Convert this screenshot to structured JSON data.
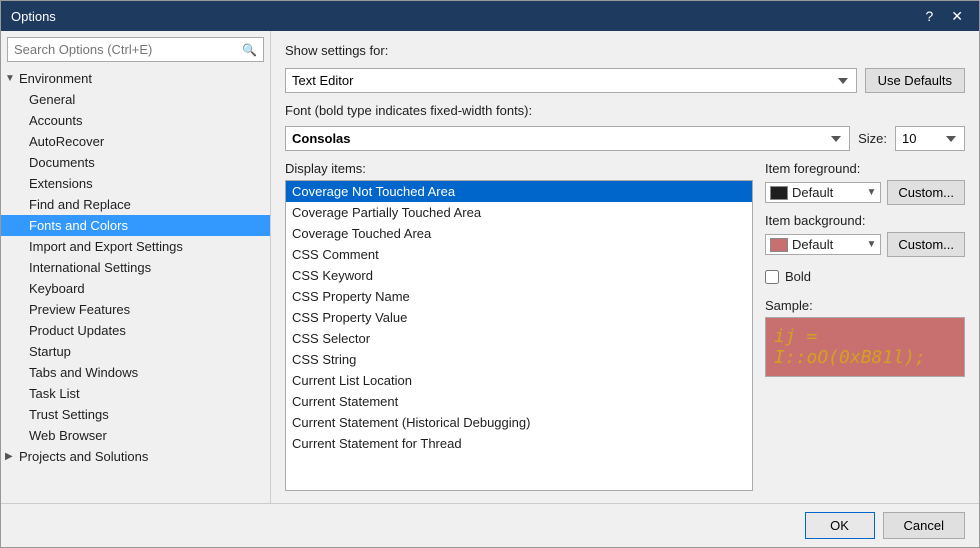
{
  "dialog": {
    "title": "Options",
    "help_label": "?",
    "close_label": "✕"
  },
  "search": {
    "placeholder": "Search Options (Ctrl+E)"
  },
  "tree": {
    "environment_label": "Environment",
    "environment_expanded": true,
    "children": [
      {
        "id": "general",
        "label": "General"
      },
      {
        "id": "accounts",
        "label": "Accounts"
      },
      {
        "id": "autorecover",
        "label": "AutoRecover"
      },
      {
        "id": "documents",
        "label": "Documents"
      },
      {
        "id": "extensions",
        "label": "Extensions"
      },
      {
        "id": "find-replace",
        "label": "Find and Replace"
      },
      {
        "id": "fonts-colors",
        "label": "Fonts and Colors",
        "selected": true
      },
      {
        "id": "import-export",
        "label": "Import and Export Settings"
      },
      {
        "id": "international",
        "label": "International Settings"
      },
      {
        "id": "keyboard",
        "label": "Keyboard"
      },
      {
        "id": "preview",
        "label": "Preview Features"
      },
      {
        "id": "product-updates",
        "label": "Product Updates"
      },
      {
        "id": "startup",
        "label": "Startup"
      },
      {
        "id": "tabs-windows",
        "label": "Tabs and Windows"
      },
      {
        "id": "task-list",
        "label": "Task List"
      },
      {
        "id": "trust-settings",
        "label": "Trust Settings"
      },
      {
        "id": "web-browser",
        "label": "Web Browser"
      }
    ],
    "projects_label": "Projects and Solutions"
  },
  "settings": {
    "show_settings_label": "Show settings for:",
    "show_settings_value": "Text Editor",
    "use_defaults_label": "Use Defaults",
    "font_label": "Font (bold type indicates fixed-width fonts):",
    "font_value": "Consolas",
    "size_label": "Size:",
    "size_value": "10",
    "display_items_label": "Display items:",
    "display_items": [
      "Coverage Not Touched Area",
      "Coverage Partially Touched Area",
      "Coverage Touched Area",
      "CSS Comment",
      "CSS Keyword",
      "CSS Property Name",
      "CSS Property Value",
      "CSS Selector",
      "CSS String",
      "Current List Location",
      "Current Statement",
      "Current Statement (Historical Debugging)",
      "Current Statement for Thread"
    ],
    "selected_item": "Coverage Not Touched Area",
    "item_foreground_label": "Item foreground:",
    "foreground_swatch_color": "#1e1e1e",
    "foreground_value": "Default",
    "item_background_label": "Item background:",
    "background_swatch_color": "#c87070",
    "background_value": "Default",
    "custom_label": "Custom...",
    "bold_label": "Bold",
    "sample_label": "Sample:",
    "sample_text": "ij = I::oO(0xB81l);"
  },
  "footer": {
    "ok_label": "OK",
    "cancel_label": "Cancel"
  }
}
